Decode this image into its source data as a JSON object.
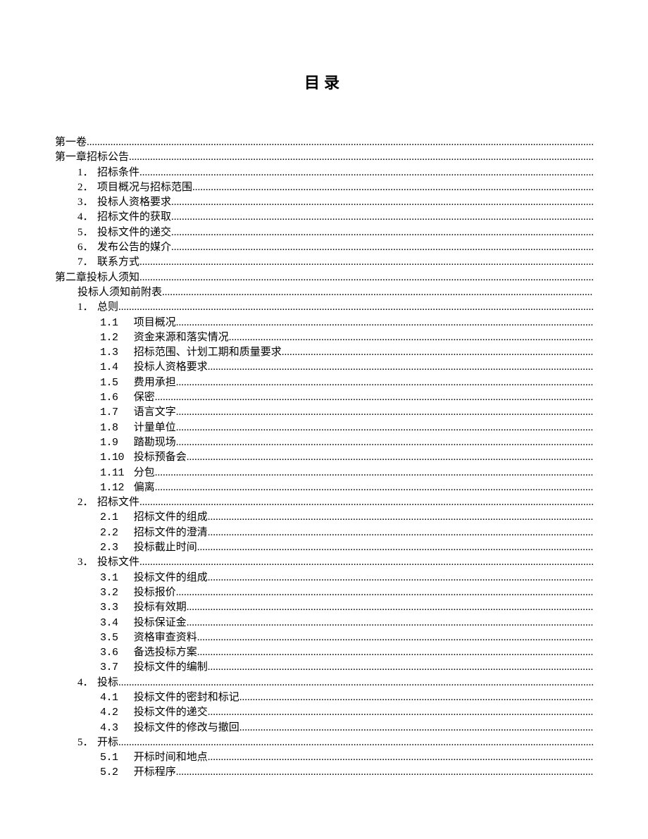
{
  "title": "目录",
  "entries": [
    {
      "level": 0,
      "num": "",
      "text": "第一卷"
    },
    {
      "level": 0,
      "num": "",
      "text": "第一章招标公告"
    },
    {
      "level": 1,
      "num": "1．",
      "text": "招标条件"
    },
    {
      "level": 1,
      "num": "2．",
      "text": "项目概况与招标范围"
    },
    {
      "level": 1,
      "num": "3．",
      "text": "投标人资格要求"
    },
    {
      "level": 1,
      "num": "4．",
      "text": "招标文件的获取"
    },
    {
      "level": 1,
      "num": "5．",
      "text": "投标文件的递交"
    },
    {
      "level": 1,
      "num": "6．",
      "text": "发布公告的媒介"
    },
    {
      "level": 1,
      "num": "7．",
      "text": "联系方式"
    },
    {
      "level": 0,
      "num": "",
      "text": "第二章投标人须知"
    },
    {
      "level": 1,
      "num": "",
      "text": "投标人须知前附表"
    },
    {
      "level": 1,
      "num": "1．",
      "text": "总则"
    },
    {
      "level": 2,
      "num": "1.1",
      "text": "项目概况"
    },
    {
      "level": 2,
      "num": "1.2",
      "text": "资金来源和落实情况"
    },
    {
      "level": 2,
      "num": "1.3",
      "text": "招标范围、计划工期和质量要求"
    },
    {
      "level": 2,
      "num": "1.4",
      "text": "投标人资格要求"
    },
    {
      "level": 2,
      "num": "1.5",
      "text": "费用承担"
    },
    {
      "level": 2,
      "num": "1.6",
      "text": "保密"
    },
    {
      "level": 2,
      "num": "1.7",
      "text": "语言文字"
    },
    {
      "level": 2,
      "num": "1.8",
      "text": "计量单位"
    },
    {
      "level": 2,
      "num": "1.9",
      "text": "踏勘现场"
    },
    {
      "level": 2,
      "num": "1.10",
      "text": "投标预备会"
    },
    {
      "level": 2,
      "num": "1.11",
      "text": "分包"
    },
    {
      "level": 2,
      "num": "1.12",
      "text": "偏离"
    },
    {
      "level": 1,
      "num": "2．",
      "text": "招标文件"
    },
    {
      "level": 2,
      "num": "2.1",
      "text": "招标文件的组成"
    },
    {
      "level": 2,
      "num": "2.2",
      "text": "招标文件的澄清"
    },
    {
      "level": 2,
      "num": "2.3",
      "text": "投标截止时间"
    },
    {
      "level": 1,
      "num": "3．",
      "text": "投标文件"
    },
    {
      "level": 2,
      "num": "3.1",
      "text": "投标文件的组成"
    },
    {
      "level": 2,
      "num": "3.2",
      "text": "投标报价"
    },
    {
      "level": 2,
      "num": "3.3",
      "text": "投标有效期"
    },
    {
      "level": 2,
      "num": "3.4",
      "text": "投标保证金"
    },
    {
      "level": 2,
      "num": "3.5",
      "text": "资格审查资料"
    },
    {
      "level": 2,
      "num": "3.6",
      "text": "备选投标方案"
    },
    {
      "level": 2,
      "num": "3.7",
      "text": "投标文件的编制"
    },
    {
      "level": 1,
      "num": "4．",
      "text": "投标"
    },
    {
      "level": 2,
      "num": "4.1",
      "text": "投标文件的密封和标记"
    },
    {
      "level": 2,
      "num": "4.2",
      "text": "投标文件的递交"
    },
    {
      "level": 2,
      "num": "4.3",
      "text": "投标文件的修改与撤回"
    },
    {
      "level": 1,
      "num": "5．",
      "text": "开标"
    },
    {
      "level": 2,
      "num": "5.1",
      "text": "开标时间和地点"
    },
    {
      "level": 2,
      "num": "5.2",
      "text": "开标程序"
    }
  ]
}
